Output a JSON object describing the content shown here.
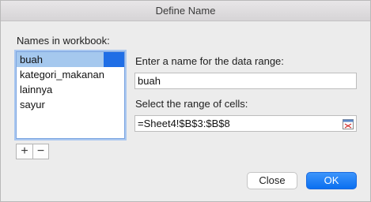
{
  "window": {
    "title": "Define Name"
  },
  "names_list": {
    "label": "Names in workbook:",
    "items": [
      {
        "label": "buah",
        "selected": true
      },
      {
        "label": "kategori_makanan",
        "selected": false
      },
      {
        "label": "lainnya",
        "selected": false
      },
      {
        "label": "sayur",
        "selected": false
      }
    ],
    "add_label": "+",
    "remove_label": "−"
  },
  "name_field": {
    "label": "Enter a name for the data range:",
    "value": "buah"
  },
  "range_field": {
    "label": "Select the range of cells:",
    "value": "=Sheet4!$B$3:$B$8",
    "icon": "collapse-range-icon"
  },
  "buttons": {
    "close_label": "Close",
    "ok_label": "OK"
  },
  "colors": {
    "selection": "#a5c8ee",
    "accent": "#1f6ee6"
  }
}
